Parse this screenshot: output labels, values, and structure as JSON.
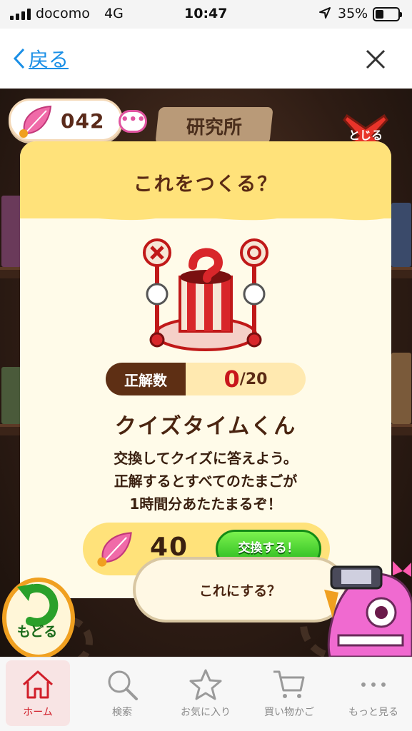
{
  "status_bar": {
    "carrier": "docomo",
    "network": "4G",
    "time": "10:47",
    "battery_percent": "35%",
    "battery_level": 0.35
  },
  "nav": {
    "back_label": "戻る",
    "accent_color": "#1a8fe6"
  },
  "game": {
    "gem_count": "042",
    "location_title": "研究所",
    "close_label": "とじる",
    "back_label": "もどる",
    "confirm_prompt": "これにする？"
  },
  "dialog": {
    "title": "これをつくる？",
    "score_label": "正解数",
    "score_current": "0",
    "score_total": "/20",
    "item_name": "クイズタイムくん",
    "description_lines": [
      "交換してクイズに答えよう。",
      "正解するとすべてのたまごが",
      "1時間分あたたまるぞ！"
    ],
    "price": "40",
    "exchange_button": "交換する！"
  },
  "tabbar": {
    "items": [
      {
        "label": "ホーム",
        "icon": "home-icon",
        "active": true
      },
      {
        "label": "検索",
        "icon": "search-icon",
        "active": false
      },
      {
        "label": "お気に入り",
        "icon": "star-icon",
        "active": false
      },
      {
        "label": "買い物かご",
        "icon": "cart-icon",
        "active": false
      },
      {
        "label": "もっと見る",
        "icon": "more-icon",
        "active": false
      }
    ],
    "active_color": "#d11f2a"
  }
}
